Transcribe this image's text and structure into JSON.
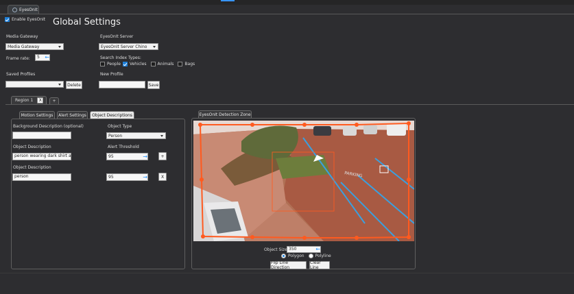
{
  "main_tab": {
    "label": "EyesOnIt"
  },
  "enable": {
    "label": "Enable EyesOnIt",
    "checked": true
  },
  "page_title": "Global Settings",
  "media_gateway": {
    "label": "Media Gateway",
    "value": "Media Gateway"
  },
  "server": {
    "label": "EyesOnIt Server",
    "value": "EyesOnIt Server Chino"
  },
  "frame_rate": {
    "label": "Frame rate:",
    "value": "5"
  },
  "search_index": {
    "label": "Search Index Types:",
    "types": [
      {
        "label": "People",
        "checked": false
      },
      {
        "label": "Vehicles",
        "checked": true
      },
      {
        "label": "Animals",
        "checked": false
      },
      {
        "label": "Bags",
        "checked": false
      }
    ]
  },
  "saved_profiles": {
    "label": "Saved Profiles",
    "value": "",
    "delete_label": "Delete"
  },
  "new_profile": {
    "label": "New Profile",
    "value": "",
    "save_label": "Save"
  },
  "region_tabs": {
    "region_label": "Region 1",
    "close_label": "X",
    "add_label": "+"
  },
  "settings_tabs": [
    "Motion Settings",
    "Alert Settings",
    "Object Descriptions"
  ],
  "object_panel": {
    "background_label": "Background Description (optional)",
    "background_value": "",
    "object_type_label": "Object Type",
    "object_type_value": "Person",
    "object_desc_label": "Object Description",
    "alert_threshold_label": "Alert Threshold",
    "rows": [
      {
        "label": "Object Description",
        "description": "person wearing dark shirt and l",
        "threshold": "95",
        "action": "+"
      },
      {
        "label": "Object Description",
        "description": "person",
        "threshold": "95",
        "action": "X"
      }
    ]
  },
  "detection": {
    "tab_label": "EyesOnIt Detection Zone",
    "object_size_label": "Object Size:",
    "object_size_value": "350",
    "polygon_label": "Polygon",
    "polyline_label": "Polyline",
    "polygon_selected": true,
    "flip_label": "Flip Line Direction",
    "clear_label": "Clear Line",
    "zone_color": "#ff5a1f"
  }
}
